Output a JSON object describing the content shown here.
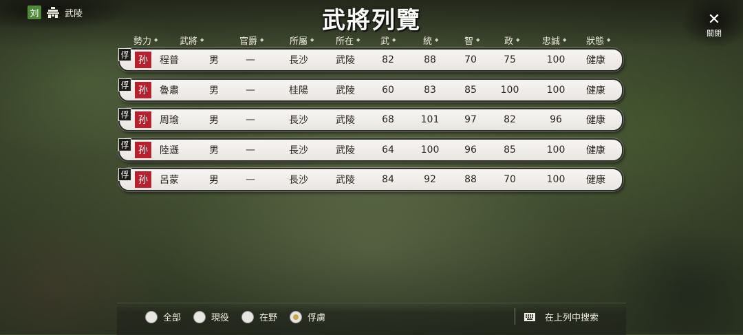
{
  "faction": {
    "badge": "刘",
    "city": "武陵"
  },
  "title": "武將列覽",
  "close_label": "關閉",
  "columns": [
    "勢力",
    "武將",
    "官爵",
    "所屬",
    "所在",
    "武",
    "統",
    "智",
    "政",
    "忠誠",
    "狀態"
  ],
  "officers": [
    {
      "prisoner": "俘",
      "clan": "孙",
      "name": "程普",
      "gender": "男",
      "rank": "—",
      "affiliation": "長沙",
      "location": "武陵",
      "war": "82",
      "lead": "88",
      "intel": "70",
      "pol": "75",
      "loyalty": "100",
      "status": "健康"
    },
    {
      "prisoner": "俘",
      "clan": "孙",
      "name": "魯肅",
      "gender": "男",
      "rank": "—",
      "affiliation": "桂陽",
      "location": "武陵",
      "war": "60",
      "lead": "83",
      "intel": "85",
      "pol": "100",
      "loyalty": "100",
      "status": "健康"
    },
    {
      "prisoner": "俘",
      "clan": "孙",
      "name": "周瑜",
      "gender": "男",
      "rank": "—",
      "affiliation": "長沙",
      "location": "武陵",
      "war": "68",
      "lead": "101",
      "intel": "97",
      "pol": "82",
      "loyalty": "96",
      "status": "健康"
    },
    {
      "prisoner": "俘",
      "clan": "孙",
      "name": "陸遜",
      "gender": "男",
      "rank": "—",
      "affiliation": "長沙",
      "location": "武陵",
      "war": "64",
      "lead": "100",
      "intel": "96",
      "pol": "85",
      "loyalty": "100",
      "status": "健康"
    },
    {
      "prisoner": "俘",
      "clan": "孙",
      "name": "呂蒙",
      "gender": "男",
      "rank": "—",
      "affiliation": "長沙",
      "location": "武陵",
      "war": "84",
      "lead": "92",
      "intel": "88",
      "pol": "70",
      "loyalty": "100",
      "status": "健康"
    }
  ],
  "filters": [
    {
      "label": "全部",
      "selected": false
    },
    {
      "label": "現役",
      "selected": false
    },
    {
      "label": "在野",
      "selected": false
    },
    {
      "label": "俘虜",
      "selected": true
    }
  ],
  "search_label": "在上列中搜索",
  "colors": {
    "clan_red": "#b8202e",
    "faction_green": "#4f8a3a",
    "radio_selected": "#c9a640"
  }
}
